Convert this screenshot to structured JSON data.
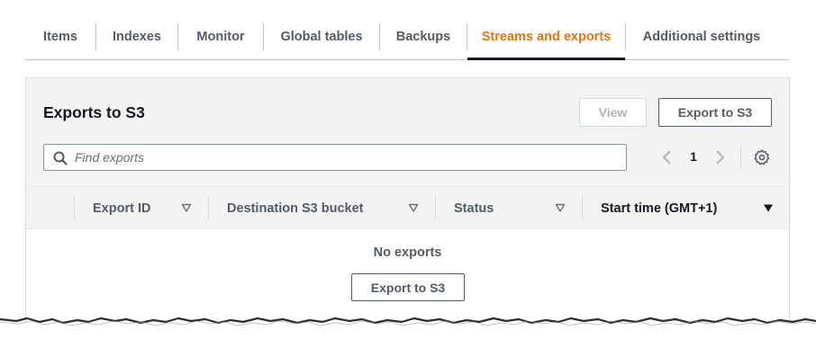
{
  "tabs": [
    {
      "label": "Items",
      "active": false
    },
    {
      "label": "Indexes",
      "active": false
    },
    {
      "label": "Monitor",
      "active": false
    },
    {
      "label": "Global tables",
      "active": false
    },
    {
      "label": "Backups",
      "active": false
    },
    {
      "label": "Streams and exports",
      "active": true
    },
    {
      "label": "Additional settings",
      "active": false
    }
  ],
  "panel": {
    "title": "Exports to S3",
    "view_label": "View",
    "export_label": "Export to S3"
  },
  "search": {
    "placeholder": "Find exports",
    "value": ""
  },
  "pagination": {
    "current_page": "1"
  },
  "table": {
    "columns": [
      {
        "label": "Export ID"
      },
      {
        "label": "Destination S3 bucket"
      },
      {
        "label": "Status"
      },
      {
        "label": "Start time (GMT+1)"
      }
    ],
    "empty_text": "No exports",
    "empty_button_label": "Export to S3"
  },
  "colors": {
    "accent": "#ec7211",
    "text_primary": "#16191f",
    "text_secondary": "#545b64",
    "panel_bg": "#f2f3f3"
  }
}
